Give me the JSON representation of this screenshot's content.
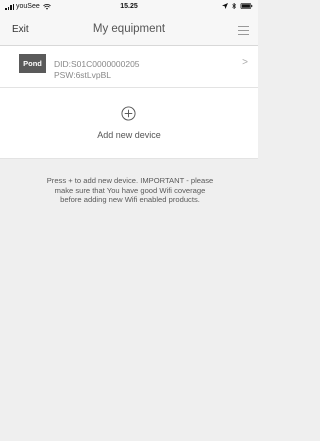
{
  "status_bar": {
    "carrier": "youSee",
    "time": "15.25",
    "icons": [
      "signal-icon",
      "wifi-icon",
      "location-arrow-icon",
      "bluetooth-icon",
      "battery-icon"
    ]
  },
  "nav": {
    "exit_label": "Exit",
    "title": "My equipment",
    "menu_icon": "hamburger-menu-icon"
  },
  "device": {
    "logo_text": "Pond",
    "did": "DID:S01C0000000205",
    "psw": "PSW:6stLvpBL",
    "chevron": ">"
  },
  "add_device": {
    "icon": "plus-circle-icon",
    "label": "Add new device"
  },
  "info_text": "Press + to add new device. IMPORTANT - please make sure that You have good Wifi coverage before adding new Wifi enabled products.",
  "colors": {
    "background": "#efefef",
    "panel": "#ffffff",
    "logo_bg": "#5a5a5a"
  }
}
